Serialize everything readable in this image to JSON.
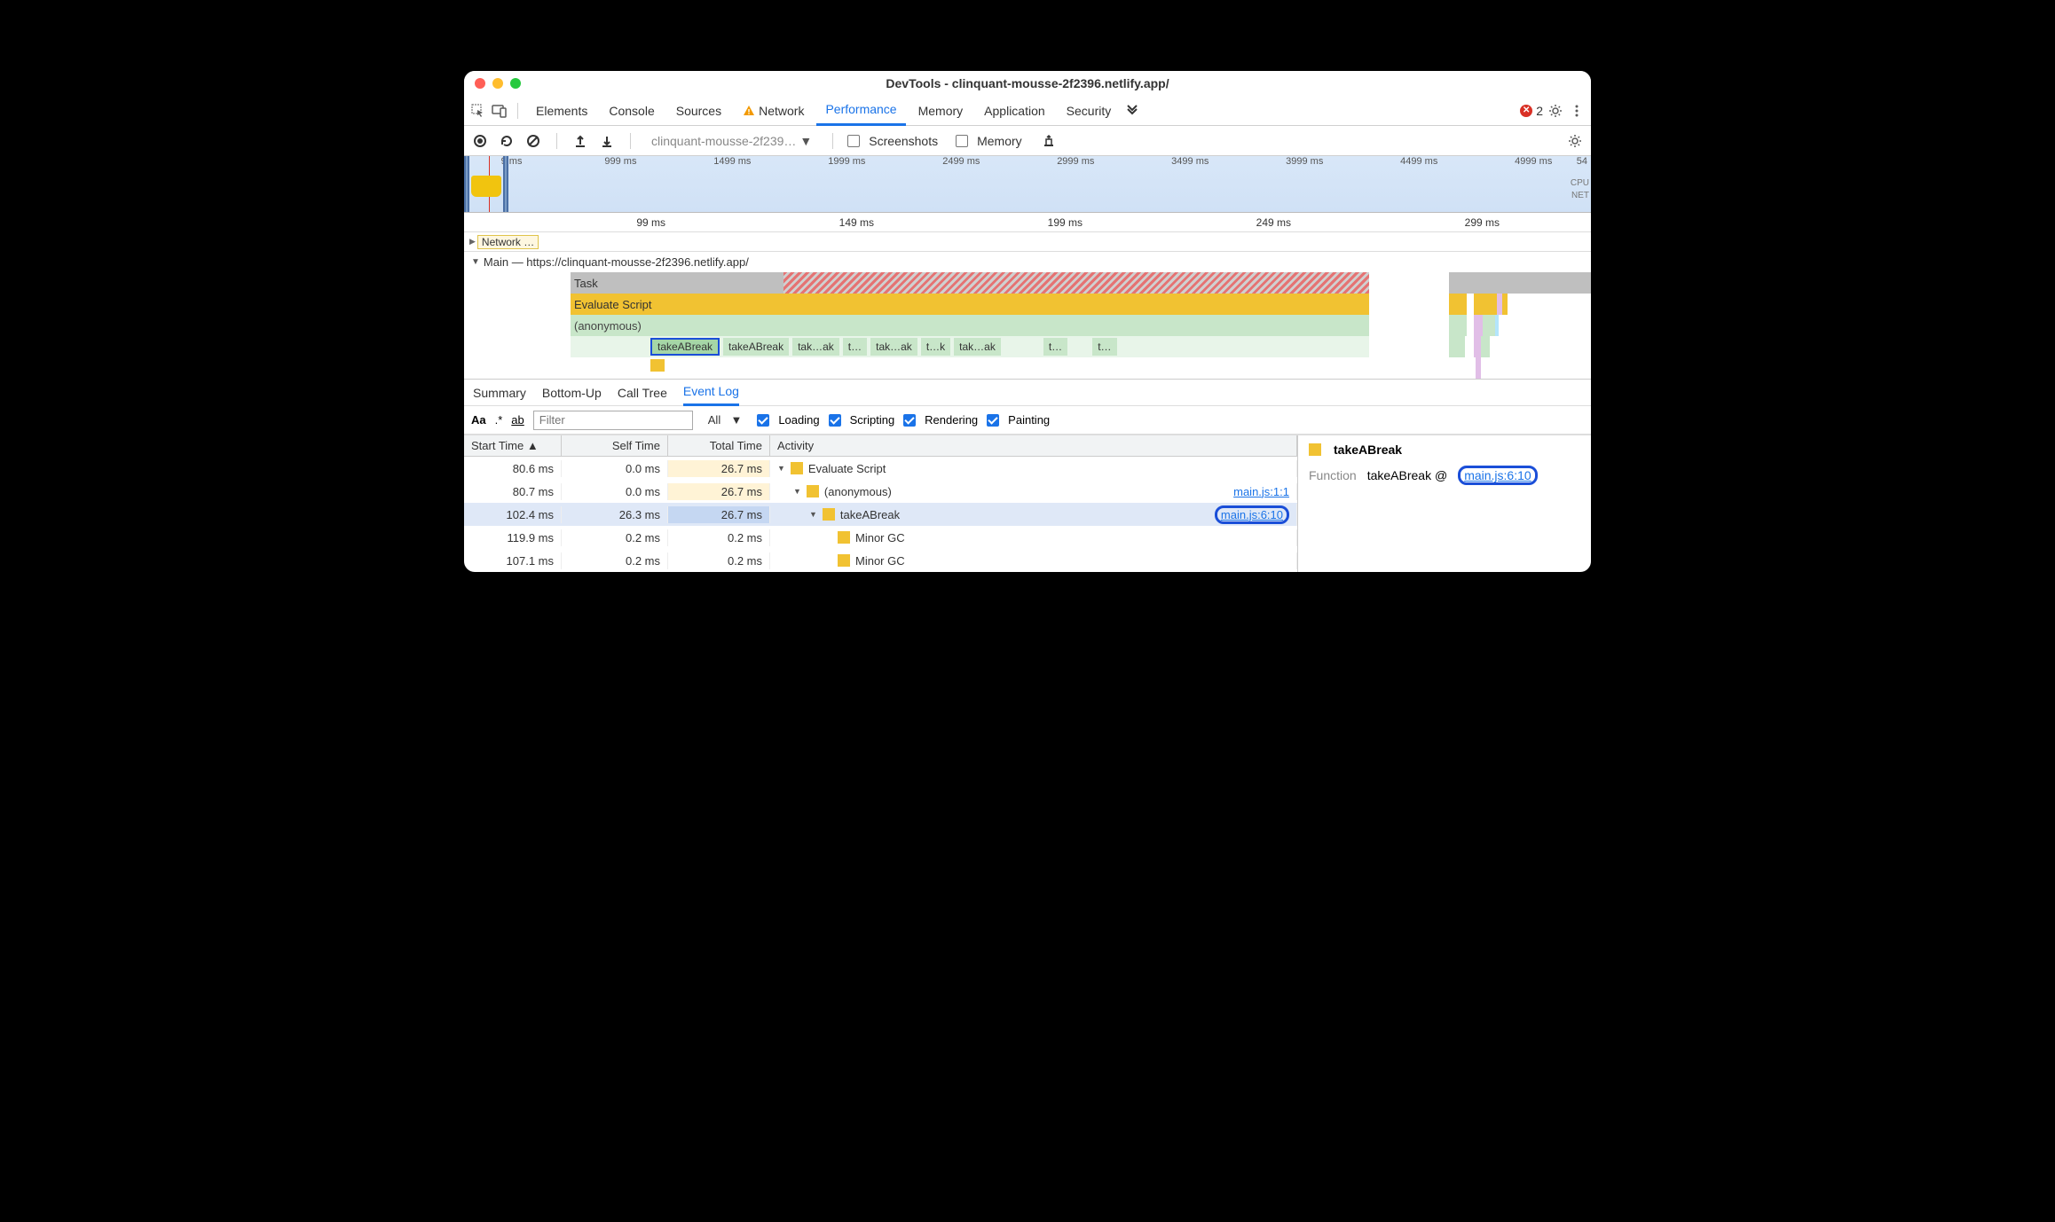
{
  "window": {
    "title": "DevTools - clinquant-mousse-2f2396.netlify.app/"
  },
  "tabs": [
    "Elements",
    "Console",
    "Sources",
    "Network",
    "Performance",
    "Memory",
    "Application",
    "Security"
  ],
  "active_tab": "Performance",
  "errors": {
    "count": "2"
  },
  "toolbar": {
    "profile_dd": "clinquant-mousse-2f239…",
    "screenshots": "Screenshots",
    "memory": "Memory"
  },
  "overview": {
    "ticks": [
      "9 ms",
      "999 ms",
      "1499 ms",
      "1999 ms",
      "2499 ms",
      "2999 ms",
      "3499 ms",
      "3999 ms",
      "4499 ms",
      "4999 ms"
    ],
    "right_tick": "54",
    "labels": [
      "CPU",
      "NET"
    ]
  },
  "ruler2": [
    "99 ms",
    "149 ms",
    "199 ms",
    "249 ms",
    "299 ms"
  ],
  "network_label": "Network …",
  "main_header": "Main — https://clinquant-mousse-2f2396.netlify.app/",
  "flame": {
    "task": "Task",
    "eval": "Evaluate Script",
    "anon": "(anonymous)",
    "calls": [
      "takeABreak",
      "takeABreak",
      "tak…ak",
      "t…",
      "tak…ak",
      "t…k",
      "tak…ak",
      "t…",
      "t…"
    ]
  },
  "bottom_tabs": [
    "Summary",
    "Bottom-Up",
    "Call Tree",
    "Event Log"
  ],
  "active_bottom_tab": "Event Log",
  "filterbar": {
    "filter_placeholder": "Filter",
    "level_dd": "All",
    "cats": [
      "Loading",
      "Scripting",
      "Rendering",
      "Painting"
    ]
  },
  "table": {
    "headers": [
      "Start Time",
      "Self Time",
      "Total Time",
      "Activity"
    ],
    "rows": [
      {
        "st": "80.6 ms",
        "self": "0.0 ms",
        "tot": "26.7 ms",
        "tot_cls": "tot-bg1",
        "indent": 0,
        "tri": "▼",
        "label": "Evaluate Script",
        "link": ""
      },
      {
        "st": "80.7 ms",
        "self": "0.0 ms",
        "tot": "26.7 ms",
        "tot_cls": "tot-bg1",
        "indent": 1,
        "tri": "▼",
        "label": "(anonymous)",
        "link": "main.js:1:1"
      },
      {
        "st": "102.4 ms",
        "self": "26.3 ms",
        "tot": "26.7 ms",
        "tot_cls": "tot-bg2",
        "indent": 2,
        "tri": "▼",
        "label": "takeABreak",
        "link": "main.js:6:10",
        "sel": true,
        "box": true
      },
      {
        "st": "119.9 ms",
        "self": "0.2 ms",
        "tot": "0.2 ms",
        "tot_cls": "",
        "indent": 3,
        "tri": "",
        "label": "Minor GC",
        "link": ""
      },
      {
        "st": "107.1 ms",
        "self": "0.2 ms",
        "tot": "0.2 ms",
        "tot_cls": "",
        "indent": 3,
        "tri": "",
        "label": "Minor GC",
        "link": ""
      }
    ]
  },
  "detail": {
    "title": "takeABreak",
    "label": "Function",
    "func": "takeABreak @",
    "link": "main.js:6:10"
  }
}
